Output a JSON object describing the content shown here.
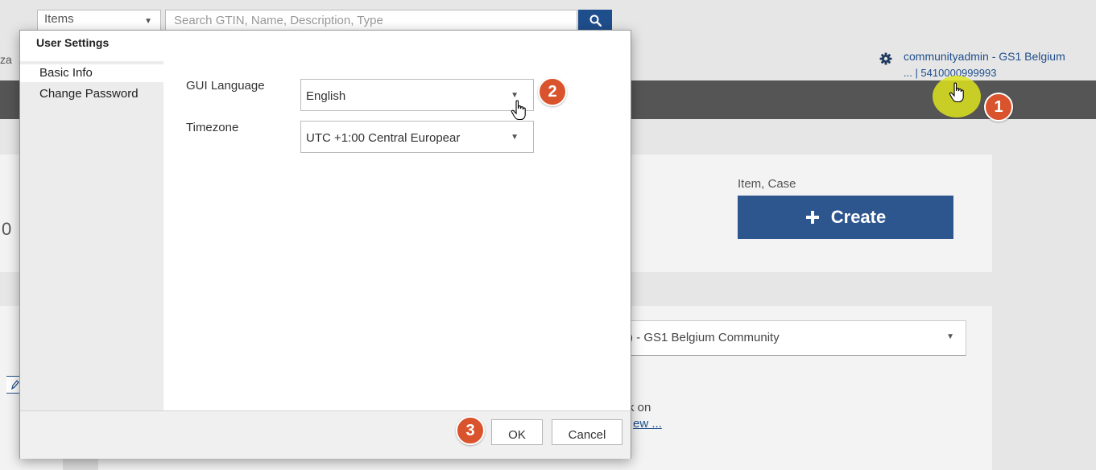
{
  "header": {
    "scope_select": "Items",
    "search_placeholder": "Search GTIN, Name, Description, Type",
    "org_fragment": "za",
    "user_line1": "communityadmin - GS1 Belgium",
    "user_line2": "... | 5410000999993"
  },
  "background": {
    "left_value_fragment": "0",
    "item_case_label": "Item, Case",
    "create_label": "Create",
    "community_select": ") - GS1 Belgium Community",
    "note_line1": "k on",
    "note_line2": "ew ..."
  },
  "dialog": {
    "title": "User Settings",
    "sidebar": [
      {
        "label": "Basic Info",
        "active": true
      },
      {
        "label": "Change Password",
        "active": false
      }
    ],
    "fields": {
      "gui_language_label": "GUI Language",
      "gui_language_value": "English",
      "timezone_label": "Timezone",
      "timezone_value": "UTC +1:00 Central Europear"
    },
    "ok_label": "OK",
    "cancel_label": "Cancel"
  },
  "annotations": {
    "step1": "1",
    "step2": "2",
    "step3": "3"
  },
  "colors": {
    "brand_blue": "#2e568e",
    "nav_dark": "#555555",
    "badge_orange": "#d9532c",
    "highlight_yellow": "#dee41e"
  },
  "icons": [
    "search-icon",
    "gear-icon",
    "plus-icon",
    "dropdown-caret-icon",
    "hand-cursor-icon",
    "edit-icon"
  ]
}
